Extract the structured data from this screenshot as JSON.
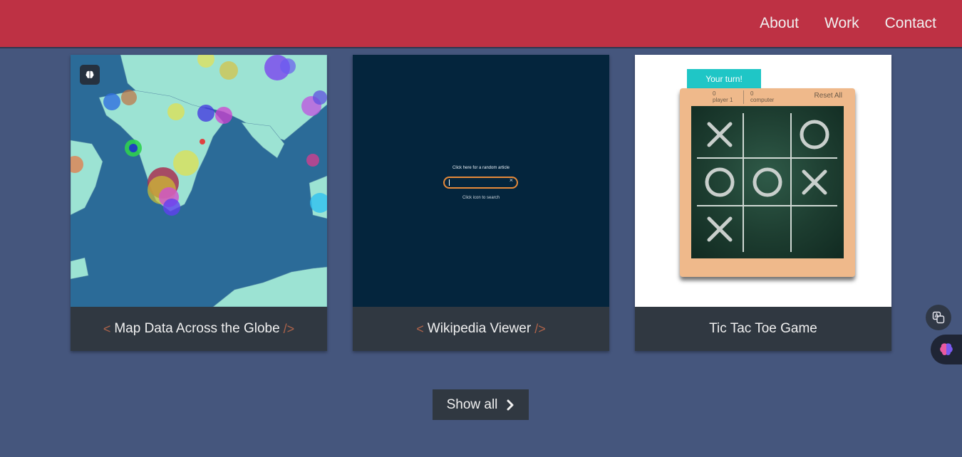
{
  "nav": {
    "links": [
      "About",
      "Work",
      "Contact"
    ]
  },
  "projects": [
    {
      "title": "Map Data Across the Globe",
      "bracket_left": "<",
      "bracket_right": "/>"
    },
    {
      "title": "Wikipedia Viewer",
      "bracket_left": "<",
      "bracket_right": "/>",
      "screenshot": {
        "random_link": "Click here for a random article",
        "hint": "Click icon to search"
      }
    },
    {
      "title": "Tic Tac Toe Game",
      "screenshot": {
        "turn_label": "Your turn!",
        "player1_score": "0",
        "player1_label": "player 1",
        "computer_score": "0",
        "computer_label": "computer",
        "reset_label": "Reset All",
        "cells": [
          "X",
          "",
          "O",
          "O",
          "O",
          "X",
          "X",
          "",
          ""
        ]
      }
    }
  ],
  "show_all": {
    "label": "Show all"
  },
  "colors": {
    "header": "#be3144",
    "background": "#45567d",
    "tile": "#303841",
    "accent": "#ff7f50"
  },
  "side_icons": [
    "translate-icon",
    "brain-icon"
  ]
}
